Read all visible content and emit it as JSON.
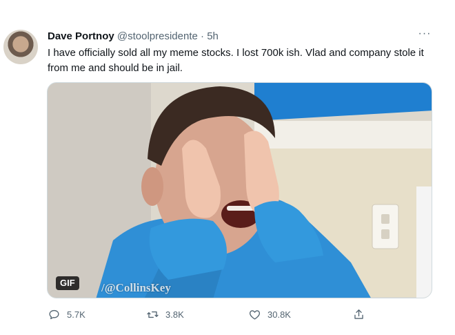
{
  "tweet": {
    "author_name": "Dave Portnoy",
    "handle": "@stoolpresidente",
    "separator": "·",
    "timestamp": "5h",
    "more_label": "···",
    "text": "I have officially sold all my meme stocks.  I lost 700k ish.   Vlad and company stole it from me and should be in jail."
  },
  "media": {
    "badge": "GIF",
    "watermark": "/@CollinsKey"
  },
  "actions": {
    "replies": "5.7K",
    "retweets": "3.8K",
    "likes": "30.8K"
  },
  "icons": {
    "reply": "comment-icon",
    "retweet": "retweet-icon",
    "like": "heart-icon",
    "share": "share-icon",
    "more": "more-icon"
  },
  "colors": {
    "text_primary": "#0f1419",
    "text_secondary": "#536471",
    "hoodie_blue": "#2f8fd6"
  }
}
